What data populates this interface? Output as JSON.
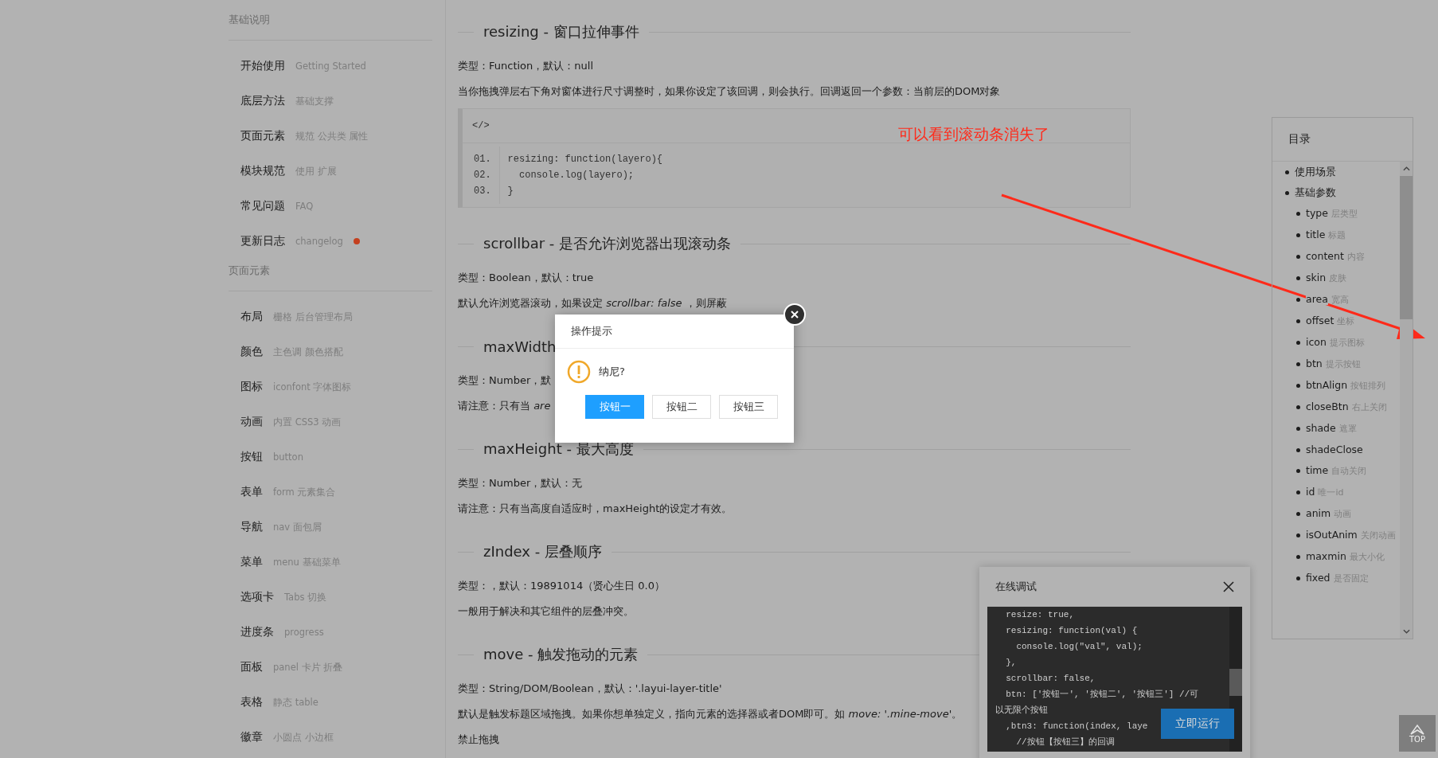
{
  "sidebar": {
    "sections": [
      {
        "title": "基础说明",
        "items": [
          {
            "label": "开始使用",
            "caption": "Getting Started"
          },
          {
            "label": "底层方法",
            "caption": "基础支撑"
          },
          {
            "label": "页面元素",
            "caption": "规范 公共类 属性"
          },
          {
            "label": "模块规范",
            "caption": "使用 扩展"
          },
          {
            "label": "常见问题",
            "caption": "FAQ"
          },
          {
            "label": "更新日志",
            "caption": "changelog",
            "dot": true
          }
        ]
      },
      {
        "title": "页面元素",
        "items": [
          {
            "label": "布局",
            "caption": "栅格 后台管理布局"
          },
          {
            "label": "颜色",
            "caption": "主色调 颜色搭配"
          },
          {
            "label": "图标",
            "caption": "iconfont 字体图标"
          },
          {
            "label": "动画",
            "caption": "内置 CSS3 动画"
          },
          {
            "label": "按钮",
            "caption": "button"
          },
          {
            "label": "表单",
            "caption": "form 元素集合"
          },
          {
            "label": "导航",
            "caption": "nav 面包屑"
          },
          {
            "label": "菜单",
            "caption": "menu 基础菜单"
          },
          {
            "label": "选项卡",
            "caption": "Tabs 切换"
          },
          {
            "label": "进度条",
            "caption": "progress"
          },
          {
            "label": "面板",
            "caption": "panel 卡片 折叠"
          },
          {
            "label": "表格",
            "caption": "静态 table"
          },
          {
            "label": "徽章",
            "caption": "小圆点 小边框"
          }
        ]
      }
    ]
  },
  "content": [
    {
      "kind": "heading",
      "text": "resizing - 窗口拉伸事件"
    },
    {
      "kind": "para",
      "text": "类型：Function，默认：null"
    },
    {
      "kind": "para",
      "text": "当你拖拽弹层右下角对窗体进行尺寸调整时，如果你设定了该回调，则会执行。回调返回一个参数：当前层的DOM对象"
    },
    {
      "kind": "code",
      "label": "</>",
      "lines": [
        {
          "no": "01.",
          "code": "resizing: function(layero){"
        },
        {
          "no": "02.",
          "code": "  console.log(layero);"
        },
        {
          "no": "03.",
          "code": "}"
        }
      ]
    },
    {
      "kind": "heading",
      "text": "scrollbar - 是否允许浏览器出现滚动条"
    },
    {
      "kind": "para",
      "text": "类型：Boolean，默认：true"
    },
    {
      "kind": "para",
      "text": "默认允许浏览器滚动，如果设定 *scrollbar: false* ，则屏蔽"
    },
    {
      "kind": "heading",
      "text": "maxWidth"
    },
    {
      "kind": "para",
      "text": "类型：Number，默"
    },
    {
      "kind": "para",
      "text": "请注意：只有当 *are*"
    },
    {
      "kind": "heading",
      "text": "maxHeight - 最大高度"
    },
    {
      "kind": "para",
      "text": "类型：Number，默认：无"
    },
    {
      "kind": "para",
      "text": "请注意：只有当高度自适应时，maxHeight的设定才有效。"
    },
    {
      "kind": "heading",
      "text": "zIndex - 层叠顺序"
    },
    {
      "kind": "para",
      "text": "类型：，默认：19891014（贤心生日 0.0）"
    },
    {
      "kind": "para",
      "text": "一般用于解决和其它组件的层叠冲突。"
    },
    {
      "kind": "heading",
      "text": "move - 触发拖动的元素"
    },
    {
      "kind": "para",
      "text": "类型：String/DOM/Boolean，默认：'.layui-layer-title'"
    },
    {
      "kind": "para",
      "text": "默认是触发标题区域拖拽。如果你想单独定义，指向元素的选择器或者DOM即可。如 *move: '.mine-move'*。"
    },
    {
      "kind": "para",
      "text": "禁止拖拽"
    }
  ],
  "annotation": {
    "text": "可以看到滚动条消失了"
  },
  "toc": {
    "title": "目录",
    "items": [
      {
        "label": "使用场景"
      },
      {
        "label": "基础参数",
        "children": [
          {
            "label": "type",
            "caption": "层类型"
          },
          {
            "label": "title",
            "caption": "标题"
          },
          {
            "label": "content",
            "caption": "内容"
          },
          {
            "label": "skin",
            "caption": "皮肤"
          },
          {
            "label": "area",
            "caption": "宽高"
          },
          {
            "label": "offset",
            "caption": "坐标"
          },
          {
            "label": "icon",
            "caption": "提示图标"
          },
          {
            "label": "btn",
            "caption": "提示按钮"
          },
          {
            "label": "btnAlign",
            "caption": "按钮排列"
          },
          {
            "label": "closeBtn",
            "caption": "右上关闭"
          },
          {
            "label": "shade",
            "caption": "遮罩"
          },
          {
            "label": "shadeClose"
          },
          {
            "label": "time",
            "caption": "自动关闭"
          },
          {
            "label": "id",
            "caption": "唯一id"
          },
          {
            "label": "anim",
            "caption": "动画"
          },
          {
            "label": "isOutAnim",
            "caption": "关闭动画"
          },
          {
            "label": "maxmin",
            "caption": "最大小化"
          },
          {
            "label": "fixed",
            "caption": "是否固定"
          }
        ]
      }
    ]
  },
  "debug_panel": {
    "title": "在线调试",
    "code": [
      "  resize: true,",
      "  resizing: function(val) {",
      "    console.log(\"val\", val);",
      "  },",
      "  scrollbar: false,",
      "  btn: ['按钮一', '按钮二', '按钮三'] //可",
      "以无限个按钮",
      "  ,btn3: function(index, laye",
      "    //按钮【按钮三】的回调"
    ],
    "run_button": "立即运行"
  },
  "top_button": "TOP",
  "dialog": {
    "title": "操作提示",
    "message": "纳尼?",
    "buttons": [
      {
        "label": "按钮一",
        "primary": true
      },
      {
        "label": "按钮二",
        "primary": false
      },
      {
        "label": "按钮三",
        "primary": false
      }
    ]
  }
}
